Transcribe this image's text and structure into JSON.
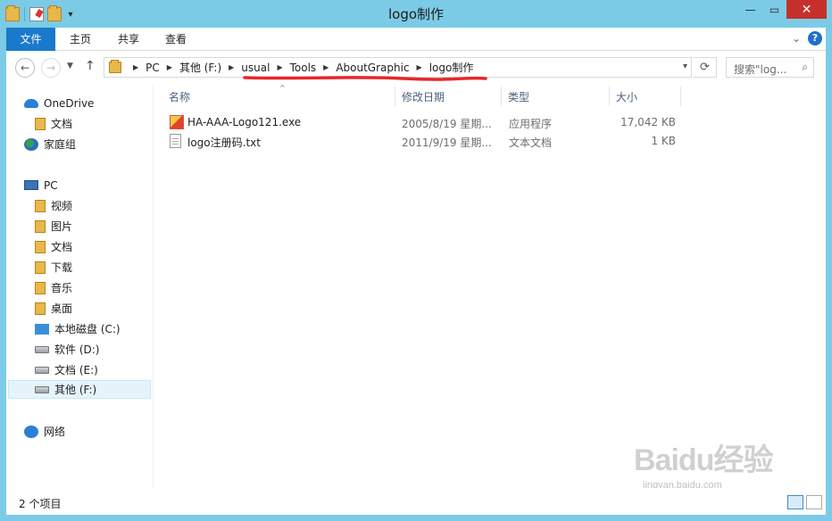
{
  "window": {
    "title": "logo制作"
  },
  "ribbon": {
    "tabs": [
      "文件",
      "主页",
      "共享",
      "查看"
    ]
  },
  "address": {
    "crumbs": [
      "PC",
      "其他 (F:)",
      "usual",
      "Tools",
      "AboutGraphic",
      "logo制作"
    ],
    "search_placeholder": "搜索\"log..."
  },
  "nav": {
    "items": [
      {
        "label": "OneDrive",
        "icon": "onedrive-icon"
      },
      {
        "label": "文档",
        "icon": "folder-icon"
      },
      {
        "label": "家庭组",
        "icon": "homegroup-icon"
      },
      {
        "label": "PC",
        "icon": "computer-icon"
      },
      {
        "label": "视频",
        "icon": "folder-icon"
      },
      {
        "label": "图片",
        "icon": "folder-icon"
      },
      {
        "label": "文档",
        "icon": "folder-icon"
      },
      {
        "label": "下载",
        "icon": "folder-icon"
      },
      {
        "label": "音乐",
        "icon": "folder-icon"
      },
      {
        "label": "桌面",
        "icon": "folder-icon"
      },
      {
        "label": "本地磁盘 (C:)",
        "icon": "drive-icon"
      },
      {
        "label": "软件 (D:)",
        "icon": "drive-icon"
      },
      {
        "label": "文档 (E:)",
        "icon": "drive-icon"
      },
      {
        "label": "其他 (F:)",
        "icon": "drive-icon"
      },
      {
        "label": "网络",
        "icon": "network-icon"
      }
    ]
  },
  "files": {
    "headers": {
      "name": "名称",
      "date": "修改日期",
      "type": "类型",
      "size": "大小"
    },
    "rows": [
      {
        "name": "HA-AAA-Logo121.exe",
        "date": "2005/8/19 星期...",
        "type": "应用程序",
        "size": "17,042 KB"
      },
      {
        "name": "logo注册码.txt",
        "date": "2011/9/19 星期...",
        "type": "文本文档",
        "size": "1 KB"
      }
    ]
  },
  "status": {
    "item_count": "2 个项目"
  },
  "watermark": {
    "logo": "Baidu经验",
    "sub": "jingyan.baidu.com"
  },
  "colors": {
    "titlebar": "#7ccbe6",
    "file_tab": "#1979ca",
    "close": "#c7302a",
    "annotation": "#e8262b"
  }
}
